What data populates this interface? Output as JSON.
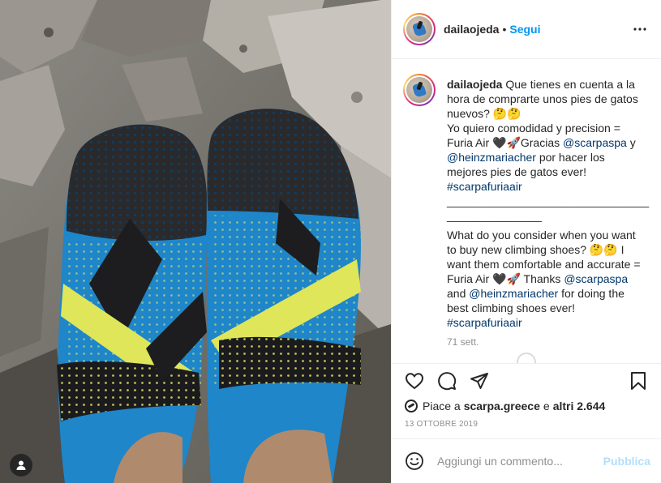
{
  "post": {
    "username": "dailaojeda",
    "separator": "•",
    "follow_label": "Segui",
    "caption": {
      "username": "dailaojeda",
      "text_1": "Que tienes en cuenta a la hora de comprarte unos pies de gatos nuevos? 🤔🤔",
      "text_2": "Yo quiero comodidad y precision = Furia Air 🖤🚀Gracias",
      "mention_1": "@scarpaspa",
      "text_3": "y",
      "mention_2": "@heinzmariacher",
      "text_4": "por hacer los mejores pies de gatos ever!",
      "hashtag_1": "#scarpafuriaair",
      "divider": "________________________________",
      "divider_2": "_______________",
      "text_5": "What do you consider when you want to buy new climbing shoes? 🤔🤔 I want them comfortable and accurate = Furia Air 🖤🚀 Thanks",
      "mention_3": "@scarpaspa",
      "text_6": "and",
      "mention_4": "@heinzmariacher",
      "text_7": "for doing the best climbing shoes ever!",
      "hashtag_2": "#scarpafuriaair"
    },
    "caption_age": "71 sett.",
    "likes": {
      "prefix": "Piace a",
      "user": "scarpa.greece",
      "conjunction": "e",
      "others": "altri 2.644"
    },
    "date": "13 OTTOBRE 2019",
    "comment_placeholder": "Aggiungi un commento...",
    "publish_label": "Pubblica"
  },
  "icons": {
    "more": "more-horizontal-icon",
    "like": "heart-icon",
    "comment": "comment-bubble-icon",
    "share": "paper-plane-icon",
    "save": "bookmark-icon",
    "emoji": "smiley-icon",
    "tag": "user-tag-icon"
  },
  "colors": {
    "link": "#00376b",
    "follow": "#0095f6",
    "publish_disabled": "#b2dffc",
    "muted": "#8e8e8e"
  }
}
